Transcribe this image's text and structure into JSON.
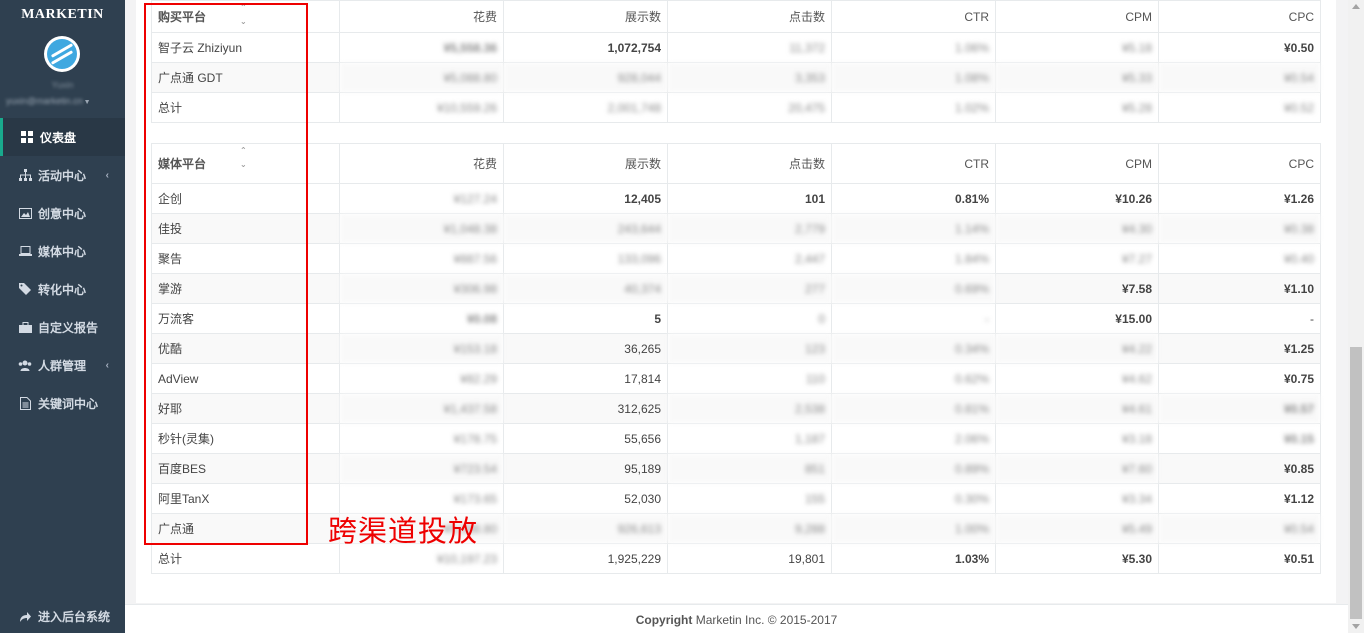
{
  "sidebar": {
    "brand": "MARKETIN",
    "user_name": "Yuxin",
    "user_email": "yuxin@marketin.cn",
    "items": [
      {
        "label": "仪表盘",
        "icon": "grid-icon",
        "active": true,
        "has_arrow": false
      },
      {
        "label": "活动中心",
        "icon": "sitemap-icon",
        "active": false,
        "has_arrow": true
      },
      {
        "label": "创意中心",
        "icon": "image-icon",
        "active": false,
        "has_arrow": false
      },
      {
        "label": "媒体中心",
        "icon": "laptop-icon",
        "active": false,
        "has_arrow": false
      },
      {
        "label": "转化中心",
        "icon": "tag-icon",
        "active": false,
        "has_arrow": false
      },
      {
        "label": "自定义报告",
        "icon": "briefcase-icon",
        "active": false,
        "has_arrow": false
      },
      {
        "label": "人群管理",
        "icon": "users-icon",
        "active": false,
        "has_arrow": true
      },
      {
        "label": "关键词中心",
        "icon": "file-text-icon",
        "active": false,
        "has_arrow": false
      }
    ],
    "back_label": "进入后台系统"
  },
  "table1": {
    "headers": [
      "购买平台",
      "花费",
      "展示数",
      "点击数",
      "CTR",
      "CPM",
      "CPC"
    ],
    "rows": [
      [
        "智子云 Zhiziyun",
        "¥5,558.36",
        "1,072,754",
        "11,372",
        "1.06%",
        "¥5.18",
        "¥0.50"
      ],
      [
        "广点通 GDT",
        "¥5,088.80",
        "928,044",
        "3,353",
        "1.08%",
        "¥5.33",
        "¥0.54"
      ],
      [
        "总计",
        "¥10,559.26",
        "2,001,748",
        "20,475",
        "1.02%",
        "¥5.28",
        "¥0.52"
      ]
    ]
  },
  "table2": {
    "headers": [
      "媒体平台",
      "花费",
      "展示数",
      "点击数",
      "CTR",
      "CPM",
      "CPC"
    ],
    "rows": [
      [
        "企创",
        "¥127.24",
        "12,405",
        "101",
        "0.81%",
        "¥10.26",
        "¥1.26"
      ],
      [
        "佳投",
        "¥1,048.38",
        "243,644",
        "2,779",
        "1.14%",
        "¥4.30",
        "¥0.38"
      ],
      [
        "聚告",
        "¥887.56",
        "133,096",
        "2,447",
        "1.84%",
        "¥7.27",
        "¥0.40"
      ],
      [
        "掌游",
        "¥306.98",
        "40,374",
        "277",
        "0.69%",
        "¥7.58",
        "¥1.10"
      ],
      [
        "万流客",
        "¥0.08",
        "5",
        "0",
        "-",
        "¥15.00",
        "-"
      ],
      [
        "优酷",
        "¥153.18",
        "36,265",
        "123",
        "0.34%",
        "¥4.22",
        "¥1.25"
      ],
      [
        "AdView",
        "¥82.29",
        "17,814",
        "110",
        "0.62%",
        "¥4.62",
        "¥0.75"
      ],
      [
        "好耶",
        "¥1,437.58",
        "312,625",
        "2,538",
        "0.81%",
        "¥4.61",
        "¥0.57"
      ],
      [
        "秒针(灵集)",
        "¥178.75",
        "55,656",
        "1,187",
        "2.06%",
        "¥3.18",
        "¥0.15"
      ],
      [
        "百度BES",
        "¥723.54",
        "95,189",
        "851",
        "0.89%",
        "¥7.60",
        "¥0.85"
      ],
      [
        "阿里TanX",
        "¥173.65",
        "52,030",
        "155",
        "0.30%",
        "¥3.34",
        "¥1.12"
      ],
      [
        "广点通",
        "¥5,088.80",
        "926,613",
        "9,288",
        "1.00%",
        "¥5.49",
        "¥0.54"
      ],
      [
        "总计",
        "¥10,197.23",
        "1,925,229",
        "19,801",
        "1.03%",
        "¥5.30",
        "¥0.51"
      ]
    ]
  },
  "annotation": "跨渠道投放",
  "footer": {
    "bold": "Copyright",
    "rest": " Marketin Inc. © 2015-2017"
  }
}
